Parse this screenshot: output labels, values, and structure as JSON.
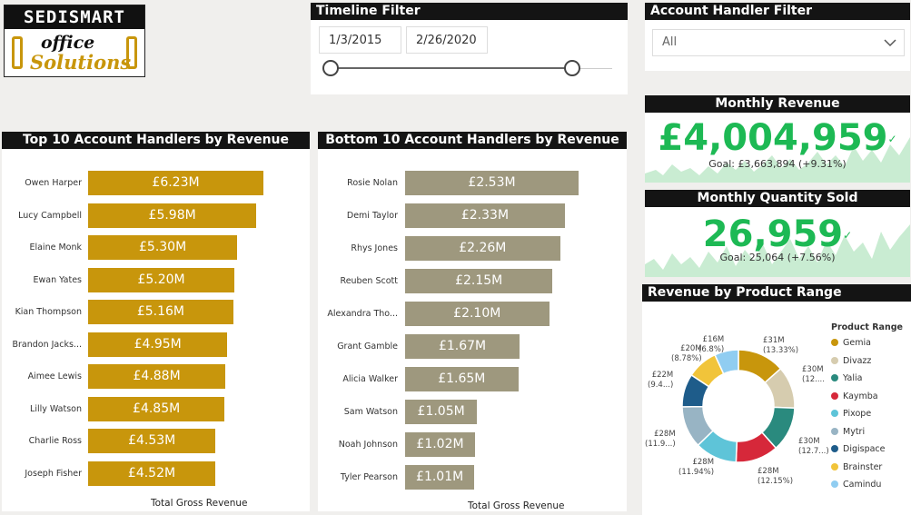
{
  "logo": {
    "line1": "SEDISMART",
    "line2": "office",
    "line3": "Solutions"
  },
  "timeline": {
    "title": "Timeline Filter",
    "start_date": "1/3/2015",
    "end_date": "2/26/2020"
  },
  "handler_filter": {
    "title": "Account Handler Filter",
    "selected": "All"
  },
  "monthly_revenue": {
    "title": "Monthly Revenue",
    "value": "£4,004,959",
    "goal": "Goal: £3,663,894 (+9.31%)",
    "status_color": "#1db954"
  },
  "monthly_quantity": {
    "title": "Monthly Quantity Sold",
    "value": "26,959",
    "goal": "Goal: 25,064 (+7.56%)",
    "status_color": "#1db954"
  },
  "chart_data": [
    {
      "type": "bar",
      "orientation": "horizontal",
      "title": "Top 10 Account Handlers by Revenue",
      "xlabel": "Total Gross Revenue",
      "color": "#c8960c",
      "categories": [
        "Owen Harper",
        "Lucy Campbell",
        "Elaine Monk",
        "Ewan Yates",
        "Kian Thompson",
        "Brandon Jacks...",
        "Aimee Lewis",
        "Lilly Watson",
        "Charlie Ross",
        "Joseph Fisher"
      ],
      "values": [
        6.23,
        5.98,
        5.3,
        5.2,
        5.16,
        4.95,
        4.88,
        4.85,
        4.53,
        4.52
      ],
      "data_labels": [
        "£6.23M",
        "£5.98M",
        "£5.30M",
        "£5.20M",
        "£5.16M",
        "£4.95M",
        "£4.88M",
        "£4.85M",
        "£4.53M",
        "£4.52M"
      ]
    },
    {
      "type": "bar",
      "orientation": "horizontal",
      "title": "Bottom 10 Account Handlers by Revenue",
      "xlabel": "Total Gross Revenue",
      "color": "#9e987e",
      "categories": [
        "Rosie Nolan",
        "Demi Taylor",
        "Rhys Jones",
        "Reuben Scott",
        "Alexandra Tho...",
        "Grant Gamble",
        "Alicia Walker",
        "Sam Watson",
        "Noah Johnson",
        "Tyler Pearson"
      ],
      "values": [
        2.53,
        2.33,
        2.26,
        2.15,
        2.1,
        1.67,
        1.65,
        1.05,
        1.02,
        1.01
      ],
      "data_labels": [
        "£2.53M",
        "£2.33M",
        "£2.26M",
        "£2.15M",
        "£2.10M",
        "£1.67M",
        "£1.65M",
        "£1.05M",
        "£1.02M",
        "£1.01M"
      ]
    },
    {
      "type": "pie",
      "variant": "donut",
      "title": "Revenue by Product Range",
      "legend_title": "Product Range",
      "legend_placement": "right",
      "categories": [
        "Gemia",
        "Divazz",
        "Yalia",
        "Kaymba",
        "Pixope",
        "Mytri",
        "Digispace",
        "Brainster",
        "Camindu"
      ],
      "values": [
        13.33,
        12.0,
        12.7,
        12.15,
        11.94,
        11.9,
        9.4,
        8.78,
        6.8
      ],
      "colors": [
        "#c8960c",
        "#d6ccaf",
        "#2a8a7e",
        "#d6283a",
        "#5ec4d8",
        "#98b4c4",
        "#1e5c8a",
        "#f1c43a",
        "#90cdf1"
      ],
      "data_labels": [
        {
          "value": "£31M",
          "pct": "(13.33%)"
        },
        {
          "value": "£30M",
          "pct": "(12...."
        },
        {
          "value": "£30M",
          "pct": "(12.7...)"
        },
        {
          "value": "£28M",
          "pct": "(12.15%)"
        },
        {
          "value": "£28M",
          "pct": "(11.94%)"
        },
        {
          "value": "£28M",
          "pct": "(11.9...)"
        },
        {
          "value": "£22M",
          "pct": "(9.4...)"
        },
        {
          "value": "£20M",
          "pct": "(8.78%)"
        },
        {
          "value": "£16M",
          "pct": "(6.8%)"
        }
      ]
    }
  ]
}
